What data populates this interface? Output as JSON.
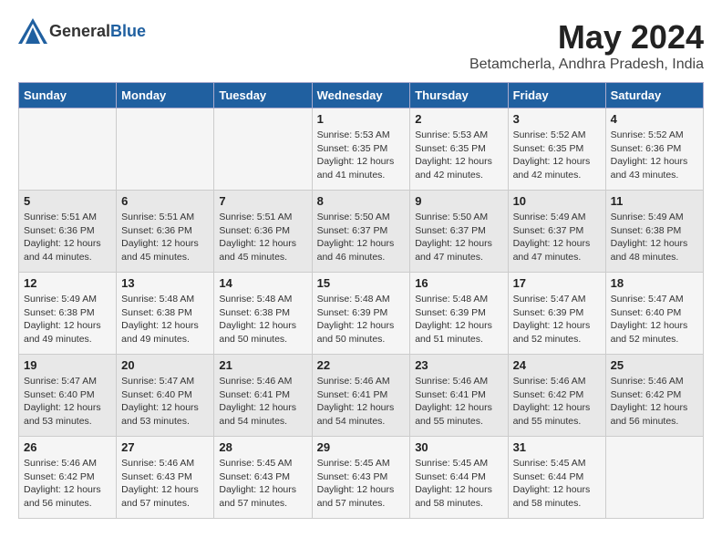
{
  "logo": {
    "general": "General",
    "blue": "Blue"
  },
  "title": {
    "month": "May 2024",
    "location": "Betamcherla, Andhra Pradesh, India"
  },
  "days_of_week": [
    "Sunday",
    "Monday",
    "Tuesday",
    "Wednesday",
    "Thursday",
    "Friday",
    "Saturday"
  ],
  "weeks": [
    [
      {
        "day": "",
        "info": ""
      },
      {
        "day": "",
        "info": ""
      },
      {
        "day": "",
        "info": ""
      },
      {
        "day": "1",
        "info": "Sunrise: 5:53 AM\nSunset: 6:35 PM\nDaylight: 12 hours\nand 41 minutes."
      },
      {
        "day": "2",
        "info": "Sunrise: 5:53 AM\nSunset: 6:35 PM\nDaylight: 12 hours\nand 42 minutes."
      },
      {
        "day": "3",
        "info": "Sunrise: 5:52 AM\nSunset: 6:35 PM\nDaylight: 12 hours\nand 42 minutes."
      },
      {
        "day": "4",
        "info": "Sunrise: 5:52 AM\nSunset: 6:36 PM\nDaylight: 12 hours\nand 43 minutes."
      }
    ],
    [
      {
        "day": "5",
        "info": "Sunrise: 5:51 AM\nSunset: 6:36 PM\nDaylight: 12 hours\nand 44 minutes."
      },
      {
        "day": "6",
        "info": "Sunrise: 5:51 AM\nSunset: 6:36 PM\nDaylight: 12 hours\nand 45 minutes."
      },
      {
        "day": "7",
        "info": "Sunrise: 5:51 AM\nSunset: 6:36 PM\nDaylight: 12 hours\nand 45 minutes."
      },
      {
        "day": "8",
        "info": "Sunrise: 5:50 AM\nSunset: 6:37 PM\nDaylight: 12 hours\nand 46 minutes."
      },
      {
        "day": "9",
        "info": "Sunrise: 5:50 AM\nSunset: 6:37 PM\nDaylight: 12 hours\nand 47 minutes."
      },
      {
        "day": "10",
        "info": "Sunrise: 5:49 AM\nSunset: 6:37 PM\nDaylight: 12 hours\nand 47 minutes."
      },
      {
        "day": "11",
        "info": "Sunrise: 5:49 AM\nSunset: 6:38 PM\nDaylight: 12 hours\nand 48 minutes."
      }
    ],
    [
      {
        "day": "12",
        "info": "Sunrise: 5:49 AM\nSunset: 6:38 PM\nDaylight: 12 hours\nand 49 minutes."
      },
      {
        "day": "13",
        "info": "Sunrise: 5:48 AM\nSunset: 6:38 PM\nDaylight: 12 hours\nand 49 minutes."
      },
      {
        "day": "14",
        "info": "Sunrise: 5:48 AM\nSunset: 6:38 PM\nDaylight: 12 hours\nand 50 minutes."
      },
      {
        "day": "15",
        "info": "Sunrise: 5:48 AM\nSunset: 6:39 PM\nDaylight: 12 hours\nand 50 minutes."
      },
      {
        "day": "16",
        "info": "Sunrise: 5:48 AM\nSunset: 6:39 PM\nDaylight: 12 hours\nand 51 minutes."
      },
      {
        "day": "17",
        "info": "Sunrise: 5:47 AM\nSunset: 6:39 PM\nDaylight: 12 hours\nand 52 minutes."
      },
      {
        "day": "18",
        "info": "Sunrise: 5:47 AM\nSunset: 6:40 PM\nDaylight: 12 hours\nand 52 minutes."
      }
    ],
    [
      {
        "day": "19",
        "info": "Sunrise: 5:47 AM\nSunset: 6:40 PM\nDaylight: 12 hours\nand 53 minutes."
      },
      {
        "day": "20",
        "info": "Sunrise: 5:47 AM\nSunset: 6:40 PM\nDaylight: 12 hours\nand 53 minutes."
      },
      {
        "day": "21",
        "info": "Sunrise: 5:46 AM\nSunset: 6:41 PM\nDaylight: 12 hours\nand 54 minutes."
      },
      {
        "day": "22",
        "info": "Sunrise: 5:46 AM\nSunset: 6:41 PM\nDaylight: 12 hours\nand 54 minutes."
      },
      {
        "day": "23",
        "info": "Sunrise: 5:46 AM\nSunset: 6:41 PM\nDaylight: 12 hours\nand 55 minutes."
      },
      {
        "day": "24",
        "info": "Sunrise: 5:46 AM\nSunset: 6:42 PM\nDaylight: 12 hours\nand 55 minutes."
      },
      {
        "day": "25",
        "info": "Sunrise: 5:46 AM\nSunset: 6:42 PM\nDaylight: 12 hours\nand 56 minutes."
      }
    ],
    [
      {
        "day": "26",
        "info": "Sunrise: 5:46 AM\nSunset: 6:42 PM\nDaylight: 12 hours\nand 56 minutes."
      },
      {
        "day": "27",
        "info": "Sunrise: 5:46 AM\nSunset: 6:43 PM\nDaylight: 12 hours\nand 57 minutes."
      },
      {
        "day": "28",
        "info": "Sunrise: 5:45 AM\nSunset: 6:43 PM\nDaylight: 12 hours\nand 57 minutes."
      },
      {
        "day": "29",
        "info": "Sunrise: 5:45 AM\nSunset: 6:43 PM\nDaylight: 12 hours\nand 57 minutes."
      },
      {
        "day": "30",
        "info": "Sunrise: 5:45 AM\nSunset: 6:44 PM\nDaylight: 12 hours\nand 58 minutes."
      },
      {
        "day": "31",
        "info": "Sunrise: 5:45 AM\nSunset: 6:44 PM\nDaylight: 12 hours\nand 58 minutes."
      },
      {
        "day": "",
        "info": ""
      }
    ]
  ]
}
